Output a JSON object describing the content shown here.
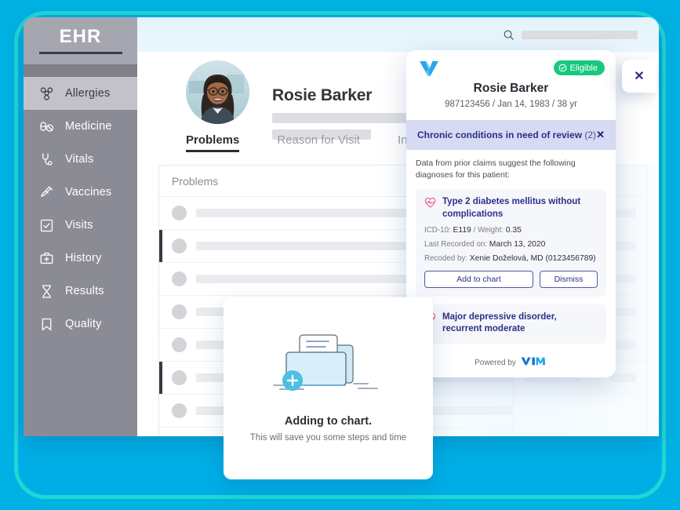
{
  "frame": {
    "accent_cyan": "#00b2e3",
    "accent_teal": "#21d6d6"
  },
  "sidebar": {
    "brand": "EHR",
    "items": [
      {
        "label": "Allergies",
        "icon": "biohazard-icon",
        "active": true
      },
      {
        "label": "Medicine",
        "icon": "pills-icon",
        "active": false
      },
      {
        "label": "Vitals",
        "icon": "stethoscope-icon",
        "active": false
      },
      {
        "label": "Vaccines",
        "icon": "syringe-icon",
        "active": false
      },
      {
        "label": "Visits",
        "icon": "checkbox-icon",
        "active": false
      },
      {
        "label": "History",
        "icon": "medical-bag-icon",
        "active": false
      },
      {
        "label": "Results",
        "icon": "dna-icon",
        "active": false
      },
      {
        "label": "Quality",
        "icon": "bookmark-icon",
        "active": false
      }
    ]
  },
  "topbar": {
    "search_icon": "search-icon",
    "search_value": ""
  },
  "patient_header": {
    "name": "Rosie Barker",
    "avatar": "patient-photo"
  },
  "tabs": [
    {
      "label": "Problems",
      "active": true
    },
    {
      "label": "Reason for Visit",
      "active": false
    },
    {
      "label": "Intake",
      "active": false
    }
  ],
  "problems_panel": {
    "header": "Problems"
  },
  "vim_card": {
    "logo": "vim-heart-logo",
    "eligible_badge": {
      "label": "Eligible",
      "icon": "check-circle-icon",
      "color": "#17c97f"
    },
    "patient_name": "Rosie Barker",
    "patient_meta": "987123456  /  Jan 14, 1983  /  38 yr",
    "section": {
      "title": "Chronic conditions in need of review",
      "count": "(2)",
      "close_glyph": "✕",
      "bg_color": "#d6daf2",
      "text_color": "#2b3087"
    },
    "intro": "Data from prior claims suggest the following diagnoses for this patient:",
    "diagnoses": [
      {
        "icon": "heart-pulse-icon",
        "title": "Type 2 diabetes mellitus without complications",
        "icd_label": "ICD-10:",
        "icd_value": "E119",
        "weight_label": "/ Weight:",
        "weight_value": "0.35",
        "last_recorded_label": "Last Recorded on:",
        "last_recorded_value": "March 13, 2020",
        "recoded_label": "Recoded by:",
        "recoded_value": "Xenie Doželová, MD (0123456789)",
        "primary_button": "Add to chart",
        "secondary_button": "Dismiss"
      },
      {
        "icon": "heart-pulse-icon",
        "title": "Major depressive disorder, recurrent moderate"
      }
    ],
    "footer": {
      "text": "Powered by",
      "logo": "vim-wordmark-logo"
    },
    "close_pill": {
      "glyph": "✕",
      "name": "close-panel-button"
    }
  },
  "adding_modal": {
    "illustration": "folder-plus-illustration",
    "title": "Adding to chart.",
    "subtitle": "This will save you some steps and time"
  }
}
